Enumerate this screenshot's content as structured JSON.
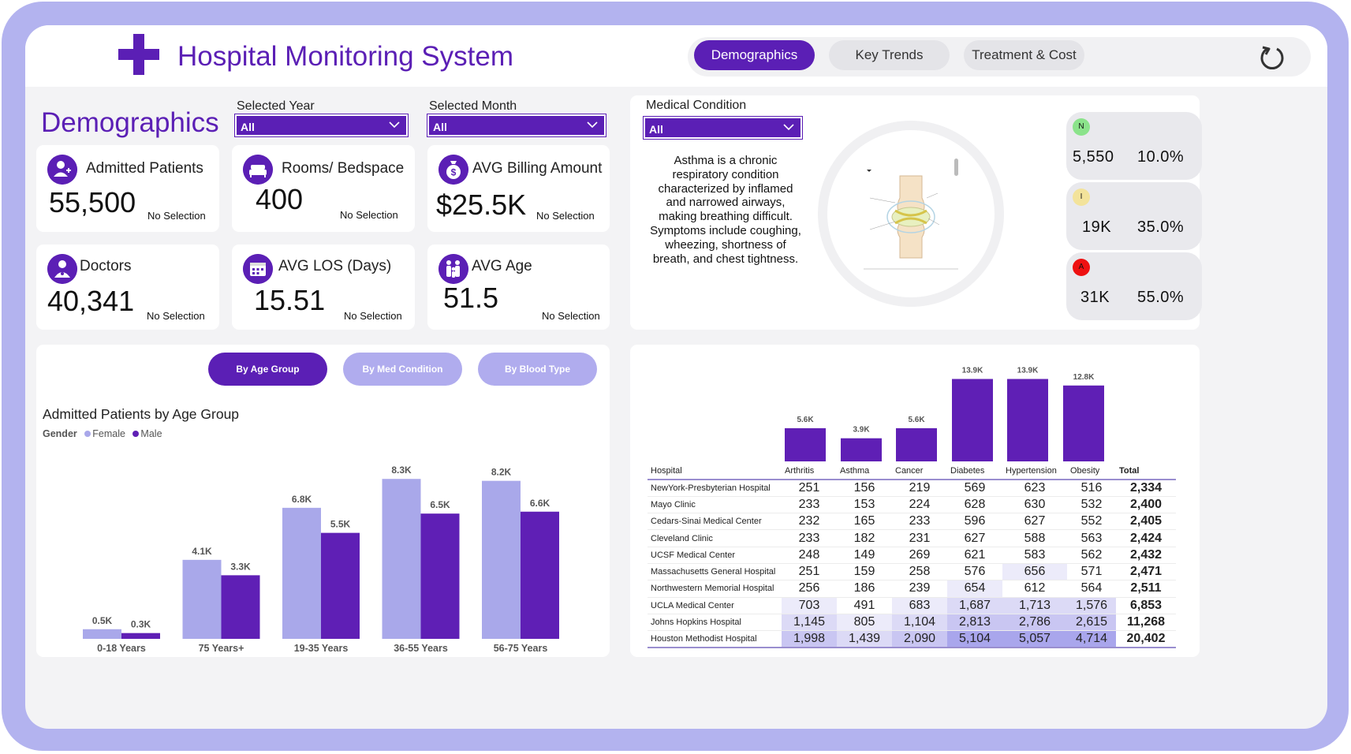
{
  "app": {
    "title": "Hospital Monitoring System"
  },
  "nav": {
    "tabs": [
      "Demographics",
      "Key Trends",
      "Treatment & Cost"
    ],
    "active": "Demographics"
  },
  "page": {
    "heading": "Demographics"
  },
  "filters": {
    "year_label": "Selected Year",
    "year_value": "All",
    "month_label": "Selected Month",
    "month_value": "All",
    "condition_label": "Medical Condition",
    "condition_value": "All"
  },
  "kpis": [
    {
      "label": "Admitted Patients",
      "value": "55,500",
      "sub": "No Selection",
      "icon": "patient-icon"
    },
    {
      "label": "Rooms/ Bedspace",
      "value": "400",
      "sub": "No Selection",
      "icon": "bed-icon"
    },
    {
      "label": "AVG Billing Amount",
      "value": "$25.5K",
      "sub": "No Selection",
      "icon": "money-bag-icon"
    },
    {
      "label": "Doctors",
      "value": "40,341",
      "sub": "No Selection",
      "icon": "doctor-icon"
    },
    {
      "label": "AVG LOS (Days)",
      "value": "15.51",
      "sub": "No Selection",
      "icon": "calendar-icon"
    },
    {
      "label": "AVG Age",
      "value": "51.5",
      "sub": "No Selection",
      "icon": "family-icon"
    }
  ],
  "condition": {
    "description": "Asthma is a chronic respiratory condition characterized by inflamed and narrowed airways, making breathing difficult. Symptoms include coughing, wheezing, shortness of breath, and chest tightness."
  },
  "result_pills": [
    {
      "letter": "N",
      "color": "#8be38b",
      "count": "5,550",
      "pct": "10.0%"
    },
    {
      "letter": "I",
      "color": "#f3e39b",
      "count": "19K",
      "pct": "35.0%"
    },
    {
      "letter": "A",
      "color": "#ee1111",
      "count": "31K",
      "pct": "55.0%"
    }
  ],
  "segment_buttons": [
    "By Age Group",
    "By Med Condition",
    "By Blood Type"
  ],
  "colors": {
    "brand": "#5b1fb5",
    "female": "#a9a8ea",
    "male": "#5f1fb5",
    "inactive_button": "#b0acee"
  },
  "chart_data": [
    {
      "type": "bar",
      "title": "Admitted Patients by Age Group",
      "legend_title": "Gender",
      "legend_position": "top-left",
      "categories": [
        "0-18 Years",
        "75 Years+",
        "19-35 Years",
        "36-55 Years",
        "56-75 Years"
      ],
      "series": [
        {
          "name": "Female",
          "values": [
            0.5,
            4.1,
            6.8,
            8.3,
            8.2
          ],
          "labels": [
            "0.5K",
            "4.1K",
            "6.8K",
            "8.3K",
            "8.2K"
          ]
        },
        {
          "name": "Male",
          "values": [
            0.3,
            3.3,
            5.5,
            6.5,
            6.6
          ],
          "labels": [
            "0.3K",
            "3.3K",
            "5.5K",
            "6.5K",
            "6.6K"
          ]
        }
      ],
      "ylim": [
        0,
        8.8
      ]
    },
    {
      "type": "bar",
      "categories": [
        "Arthritis",
        "Asthma",
        "Cancer",
        "Diabetes",
        "Hypertension",
        "Obesity"
      ],
      "values": [
        5.6,
        3.9,
        5.6,
        13.9,
        13.9,
        12.8
      ],
      "labels": [
        "5.6K",
        "3.9K",
        "5.6K",
        "13.9K",
        "13.9K",
        "12.8K"
      ],
      "ylim": [
        0,
        14.5
      ]
    }
  ],
  "matrix": {
    "headers": [
      "Hospital",
      "Arthritis",
      "Asthma",
      "Cancer",
      "Diabetes",
      "Hypertension",
      "Obesity",
      "Total"
    ],
    "rows": [
      [
        "NewYork-Presbyterian Hospital",
        "251",
        "156",
        "219",
        "569",
        "623",
        "516",
        "2,334"
      ],
      [
        "Mayo Clinic",
        "233",
        "153",
        "224",
        "628",
        "630",
        "532",
        "2,400"
      ],
      [
        "Cedars-Sinai Medical Center",
        "232",
        "165",
        "233",
        "596",
        "627",
        "552",
        "2,405"
      ],
      [
        "Cleveland Clinic",
        "233",
        "182",
        "231",
        "627",
        "588",
        "563",
        "2,424"
      ],
      [
        "UCSF Medical Center",
        "248",
        "149",
        "269",
        "621",
        "583",
        "562",
        "2,432"
      ],
      [
        "Massachusetts General Hospital",
        "251",
        "159",
        "258",
        "576",
        "656",
        "571",
        "2,471"
      ],
      [
        "Northwestern Memorial Hospital",
        "256",
        "186",
        "239",
        "654",
        "612",
        "564",
        "2,511"
      ],
      [
        "UCLA Medical Center",
        "703",
        "491",
        "683",
        "1,687",
        "1,713",
        "1,576",
        "6,853"
      ],
      [
        "Johns Hopkins Hospital",
        "1,145",
        "805",
        "1,104",
        "2,813",
        "2,786",
        "2,615",
        "11,268"
      ],
      [
        "Houston Methodist Hospital",
        "1,998",
        "1,439",
        "2,090",
        "5,104",
        "5,057",
        "4,714",
        "20,402"
      ]
    ]
  }
}
